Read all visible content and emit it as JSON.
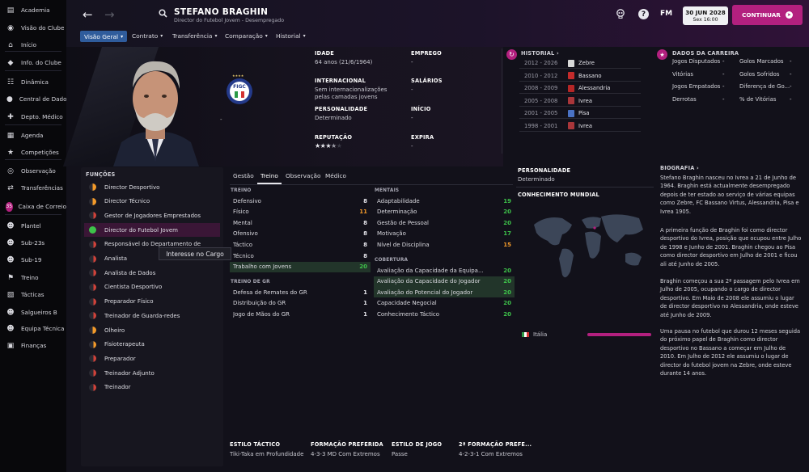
{
  "colors": {
    "accent": "#b3207f",
    "tab_active": "#2f5c9c",
    "green": "#3ec24a",
    "orange": "#f39a2a",
    "red": "#e04637"
  },
  "sidebar": {
    "items": [
      {
        "label": "Academia",
        "icon": "academy-icon"
      },
      {
        "label": "Visão do Clube",
        "icon": "club-vision-icon"
      },
      {
        "label": "Início",
        "icon": "home-icon"
      },
      {
        "label": "Info. do Clube",
        "icon": "club-info-icon"
      },
      {
        "label": "Dinâmica",
        "icon": "dynamics-icon"
      },
      {
        "label": "Central de Dados",
        "icon": "data-hub-icon"
      },
      {
        "label": "Depto. Médico",
        "icon": "medical-icon"
      },
      {
        "label": "Agenda",
        "icon": "calendar-icon"
      },
      {
        "label": "Competições",
        "icon": "trophy-icon"
      },
      {
        "label": "Observação",
        "icon": "scouting-icon"
      },
      {
        "label": "Transferências",
        "icon": "transfers-icon"
      },
      {
        "label": "Caixa de Correio",
        "icon": "inbox-icon",
        "badge": "35"
      },
      {
        "label": "Plantel",
        "icon": "squad-icon"
      },
      {
        "label": "Sub-23s",
        "icon": "u23-icon"
      },
      {
        "label": "Sub-19",
        "icon": "u19-icon"
      },
      {
        "label": "Treino",
        "icon": "training-icon"
      },
      {
        "label": "Tácticas",
        "icon": "tactics-icon"
      },
      {
        "label": "Salgueiros B",
        "icon": "b-team-icon"
      },
      {
        "label": "Equipa Técnica",
        "icon": "staff-icon"
      },
      {
        "label": "Finanças",
        "icon": "finances-icon"
      }
    ]
  },
  "header": {
    "name": "STEFANO BRAGHIN",
    "subtitle": "Director do Futebol Jovem - Desempregado",
    "logo": "FM",
    "date": "30 JUN 2028",
    "time": "Sex 16:00",
    "continue": "CONTINUAR"
  },
  "nav": {
    "tabs": [
      "Visão Geral",
      "Contrato",
      "Transferência",
      "Comparação",
      "Historial"
    ]
  },
  "crest_text": "FIGC",
  "info": {
    "age_label": "IDADE",
    "age_value": "64 anos (21/6/1964)",
    "intl_label": "INTERNACIONAL",
    "intl_value1": "Sem internacionalizações",
    "intl_value2": "pelas camadas jovens",
    "pers_label": "PERSONALIDADE",
    "pers_value": "Determinado",
    "rep_label": "REPUTAÇÃO",
    "rep_stars": 3.5,
    "job_label": "EMPREGO",
    "job_value": "-",
    "salary_label": "SALÁRIOS",
    "salary_value": "-",
    "start_label": "INÍCIO",
    "start_value": "-",
    "expire_label": "EXPIRA",
    "expire_value": "-"
  },
  "history": {
    "title": "HISTORIAL",
    "rows": [
      {
        "years": "2012 - 2026",
        "club": "Zebre",
        "color": "#d8d8d8"
      },
      {
        "years": "2010 - 2012",
        "club": "Bassano",
        "color": "#c42b2b"
      },
      {
        "years": "2008 - 2009",
        "club": "Alessandria",
        "color": "#b52626"
      },
      {
        "years": "2005 - 2008",
        "club": "Ivrea",
        "color": "#a9363a"
      },
      {
        "years": "2001 - 2005",
        "club": "Pisa",
        "color": "#4a72c4"
      },
      {
        "years": "1998 - 2001",
        "club": "Ivrea",
        "color": "#a9363a"
      }
    ]
  },
  "career": {
    "title": "DADOS DA CARREIRA",
    "rows": [
      [
        "Jogos Disputados",
        "-",
        "Golos Marcados",
        "-"
      ],
      [
        "Vitórias",
        "-",
        "Golos Sofridos",
        "-"
      ],
      [
        "Jogos Empatados",
        "-",
        "Diferença de Go...",
        "-"
      ],
      [
        "Derrotas",
        "-",
        "% de Vitórias",
        "-"
      ]
    ]
  },
  "functions": {
    "title": "FUNÇÕES",
    "tooltip": "Interesse no Cargo",
    "items": [
      {
        "label": "Director Desportivo",
        "fill": "half-orange"
      },
      {
        "label": "Director Técnico",
        "fill": "half-orange"
      },
      {
        "label": "Gestor de Jogadores Emprestados",
        "fill": "small-red"
      },
      {
        "label": "Director do Futebol Jovem",
        "fill": "full-green",
        "selected": true
      },
      {
        "label": "Responsável do Departamento de",
        "fill": "small-red"
      },
      {
        "label": "Analista",
        "fill": "small-red"
      },
      {
        "label": "Analista de Dados",
        "fill": "small-red"
      },
      {
        "label": "Cientista Desportivo",
        "fill": "small-red"
      },
      {
        "label": "Preparador Físico",
        "fill": "small-red"
      },
      {
        "label": "Treinador de Guarda-redes",
        "fill": "small-red"
      },
      {
        "label": "Olheiro",
        "fill": "half-orange"
      },
      {
        "label": "Fisioterapeuta",
        "fill": "small-orange"
      },
      {
        "label": "Preparador",
        "fill": "small-red"
      },
      {
        "label": "Treinador Adjunto",
        "fill": "small-red"
      },
      {
        "label": "Treinador",
        "fill": "small-red"
      }
    ]
  },
  "subtabs": [
    "Gestão",
    "Treino",
    "Observação",
    "Médico"
  ],
  "attributes": {
    "training_title": "TREINO",
    "training": [
      {
        "n": "Defensivo",
        "v": "8",
        "c": "w"
      },
      {
        "n": "Físico",
        "v": "11",
        "c": "o"
      },
      {
        "n": "Mental",
        "v": "8",
        "c": "w"
      },
      {
        "n": "Ofensivo",
        "v": "8",
        "c": "w"
      },
      {
        "n": "Táctico",
        "v": "8",
        "c": "w"
      },
      {
        "n": "Técnico",
        "v": "8",
        "c": "w"
      },
      {
        "n": "Trabalho com Jovens",
        "v": "20",
        "c": "g",
        "hl": true
      }
    ],
    "gk_title": "TREINO DE GR",
    "gk": [
      {
        "n": "Defesa de Remates do GR",
        "v": "1",
        "c": "w"
      },
      {
        "n": "Distribuição do GR",
        "v": "1",
        "c": "w"
      },
      {
        "n": "Jogo de Mãos do GR",
        "v": "1",
        "c": "w"
      }
    ],
    "mental_title": "MENTAIS",
    "mental": [
      {
        "n": "Adaptabilidade",
        "v": "19",
        "c": "g"
      },
      {
        "n": "Determinação",
        "v": "20",
        "c": "g"
      },
      {
        "n": "Gestão de Pessoal",
        "v": "20",
        "c": "g"
      },
      {
        "n": "Motivação",
        "v": "17",
        "c": "g"
      },
      {
        "n": "Nível de Disciplina",
        "v": "15",
        "c": "o"
      }
    ],
    "coverage_title": "COBERTURA",
    "coverage": [
      {
        "n": "Avaliação da Capacidade da Equipa...",
        "v": "20",
        "c": "g"
      },
      {
        "n": "Avaliação da Capacidade do Jogador",
        "v": "20",
        "c": "g",
        "hl": true
      },
      {
        "n": "Avaliação do Potencial do Jogador",
        "v": "20",
        "c": "g",
        "hl": true
      },
      {
        "n": "Capacidade Negocial",
        "v": "20",
        "c": "g"
      },
      {
        "n": "Conhecimento Táctico",
        "v": "20",
        "c": "g"
      }
    ]
  },
  "personality": {
    "label": "PERSONALIDADE",
    "value": "Determinado"
  },
  "world": {
    "label": "CONHECIMENTO MUNDIAL",
    "country": "Itália",
    "level": 1.0
  },
  "biography": {
    "title": "BIOGRAFIA",
    "p1": "Stefano Braghin nasceu no Ivrea a 21 de Junho de 1964. Braghin está actualmente desempregado depois de ter estado ao serviço de várias equipas como Zebre, FC Bassano Virtus, Alessandria, Pisa e Ivrea 1905.",
    "p2": "A primeira função de Braghin foi como director desportivo do Ivrea, posição que ocupou entre Julho de 1998 e Junho de 2001. Braghin chegou ao Pisa como director desportivo em Julho de 2001 e ficou ali até Junho de 2005.",
    "p3": "Braghin começou a sua 2ª passagem pelo Ivrea em Julho de 2005, ocupando o cargo de director desportivo. Em Maio de 2008 ele assumiu o lugar de director desportivo no Alessandria, onde esteve até Junho de 2009.",
    "p4": "Uma pausa no futebol que durou 12 meses seguida do próximo papel de Braghin como director desportivo no Bassano a começar em Julho de 2010. Em Julho de 2012 ele assumiu o lugar de director do futebol jovem na Zebre, onde esteve durante 14 anos."
  },
  "style": {
    "tactical_label": "ESTILO TÁCTICO",
    "tactical_value": "Tiki-Taka em Profundidade",
    "formation_label": "FORMAÇÃO PREFERIDA",
    "formation_value": "4-3-3 MD Com Extremos",
    "play_label": "ESTILO DE JOGO",
    "play_value": "Passe",
    "formation2_label": "2ª FORMAÇÃO PREFE...",
    "formation2_value": "4-2-3-1 Com Extremos"
  }
}
